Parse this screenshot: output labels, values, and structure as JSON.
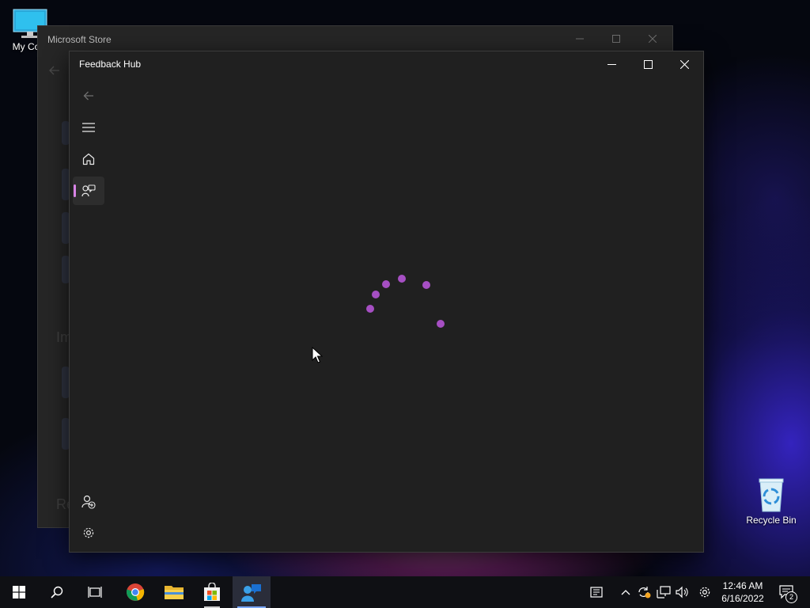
{
  "desktop": {
    "icons": [
      {
        "label": "My Com"
      },
      {
        "label": "Recycle Bin"
      }
    ]
  },
  "store_window": {
    "title": "Microsoft Store",
    "ghost_texts": [
      "Im",
      "Re"
    ]
  },
  "feedback_window": {
    "title": "Feedback Hub",
    "nav": [
      {
        "icon": "back-arrow-icon"
      },
      {
        "icon": "hamburger-menu-icon"
      },
      {
        "icon": "home-icon"
      },
      {
        "icon": "feedback-icon",
        "active": true
      }
    ],
    "bottom_nav": [
      {
        "icon": "add-user-icon"
      },
      {
        "icon": "gear-icon"
      }
    ],
    "loading": true,
    "accent": "#a64fc3"
  },
  "taskbar": {
    "apps": [
      "start",
      "search",
      "task-view",
      "chrome",
      "file-explorer",
      "microsoft-store",
      "feedback-hub"
    ],
    "time": "12:46 AM",
    "date": "6/16/2022",
    "notification_count": "2"
  }
}
